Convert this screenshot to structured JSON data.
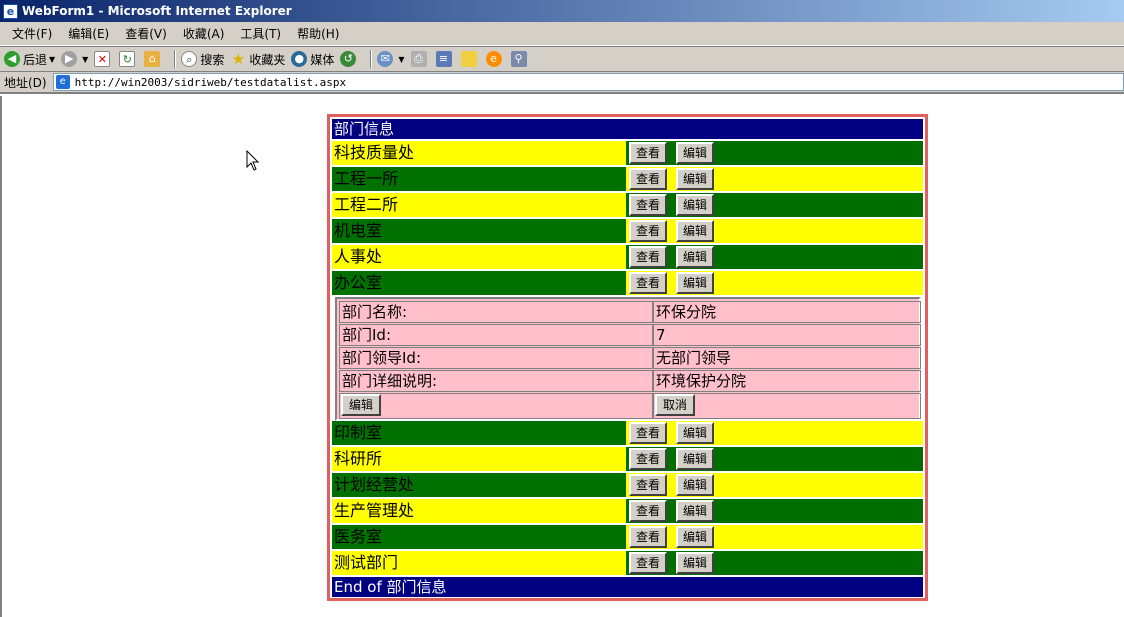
{
  "window": {
    "title": "WebForm1 - Microsoft Internet Explorer"
  },
  "menu": [
    "文件(F)",
    "编辑(E)",
    "查看(V)",
    "收藏(A)",
    "工具(T)",
    "帮助(H)"
  ],
  "toolbar": {
    "back_label": "后退",
    "search_label": "搜索",
    "favorites_label": "收藏夹",
    "media_label": "媒体"
  },
  "address": {
    "label": "地址(D)",
    "url": "http://win2003/sidriweb/testdatalist.aspx"
  },
  "datalist": {
    "header": "部门信息",
    "footer": "End of 部门信息",
    "view_label": "查看",
    "edit_label": "编辑",
    "rows_top": [
      "科技质量处",
      "工程一所",
      "工程二所",
      "机电室",
      "人事处",
      "办公室"
    ],
    "rows_bottom": [
      "印制室",
      "科研所",
      "计划经营处",
      "生产管理处",
      "医务室",
      "测试部门"
    ],
    "edit_panel": {
      "fields": [
        {
          "label": "部门名称:",
          "value": "环保分院"
        },
        {
          "label": "部门Id:",
          "value": "7"
        },
        {
          "label": "部门领导Id:",
          "value": "无部门领导"
        },
        {
          "label": "部门详细说明:",
          "value": "环境保护分院"
        }
      ],
      "save_label": "编辑",
      "cancel_label": "取消"
    }
  },
  "colors": {
    "header_bg": "#000080",
    "yellow": "#ffff00",
    "green": "#007000",
    "edit_bg": "#ffc0cb",
    "border": "#e06060"
  }
}
